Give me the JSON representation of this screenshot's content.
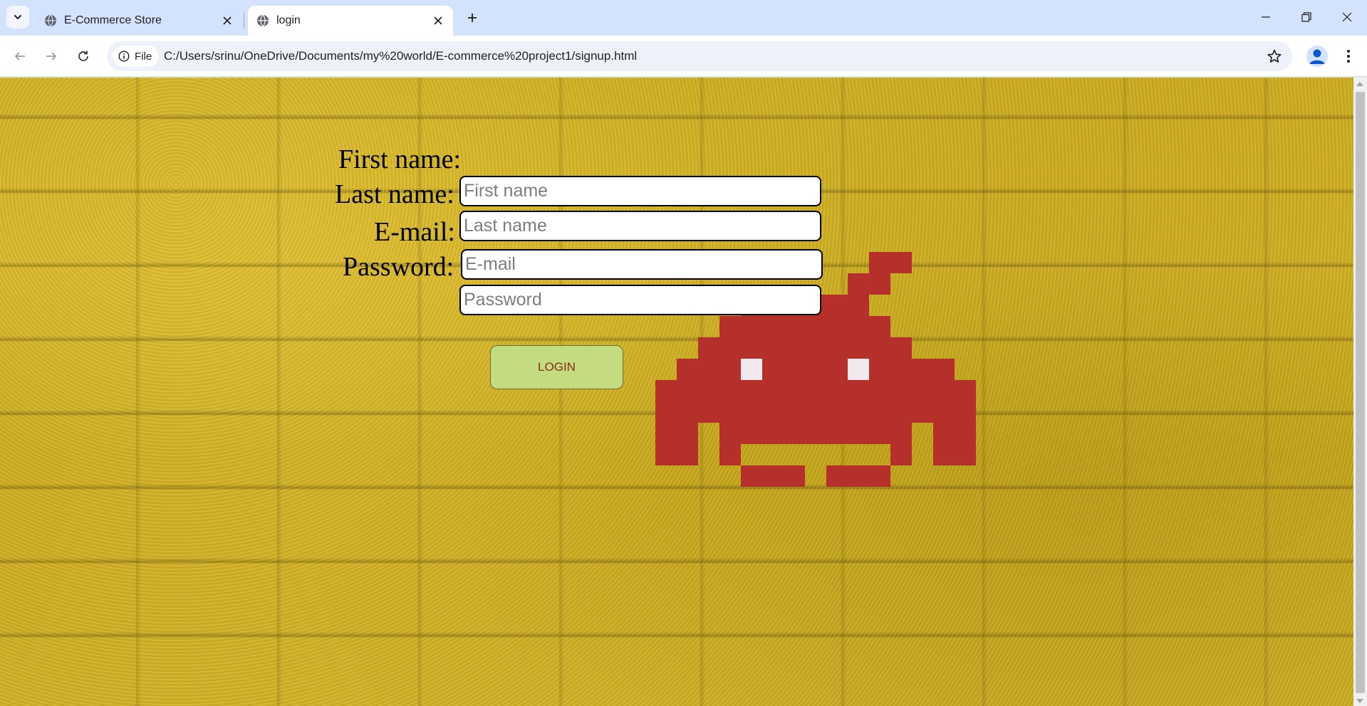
{
  "browser": {
    "tabs": [
      {
        "title": "E-Commerce Store",
        "active": false
      },
      {
        "title": "login",
        "active": true
      }
    ],
    "address": {
      "chip_label": "File",
      "url": "C:/Users/srinu/OneDrive/Documents/my%20world/E-commerce%20project1/signup.html"
    },
    "icons": {
      "tab_search": "chevron-down-icon",
      "favicon": "globe-icon",
      "close": "close-icon",
      "new_tab": "plus-icon",
      "back": "back-arrow-icon",
      "forward": "forward-arrow-icon",
      "reload": "reload-icon",
      "site_info": "info-icon",
      "bookmark": "star-icon",
      "profile": "profile-icon",
      "menu": "kebab-menu-icon"
    }
  },
  "form": {
    "first_name": {
      "label": "First name:",
      "placeholder": "First name"
    },
    "last_name": {
      "label": "Last name:",
      "placeholder": "Last name"
    },
    "email": {
      "label": "E-mail:",
      "placeholder": "E-mail"
    },
    "password": {
      "label": "Password:",
      "placeholder": "Password"
    },
    "submit_label": "LOGIN"
  },
  "colors": {
    "background": "#d2b22a",
    "button_bg": "#c3dc80",
    "button_text": "#8a2c1a",
    "invader": "#b5302a"
  }
}
